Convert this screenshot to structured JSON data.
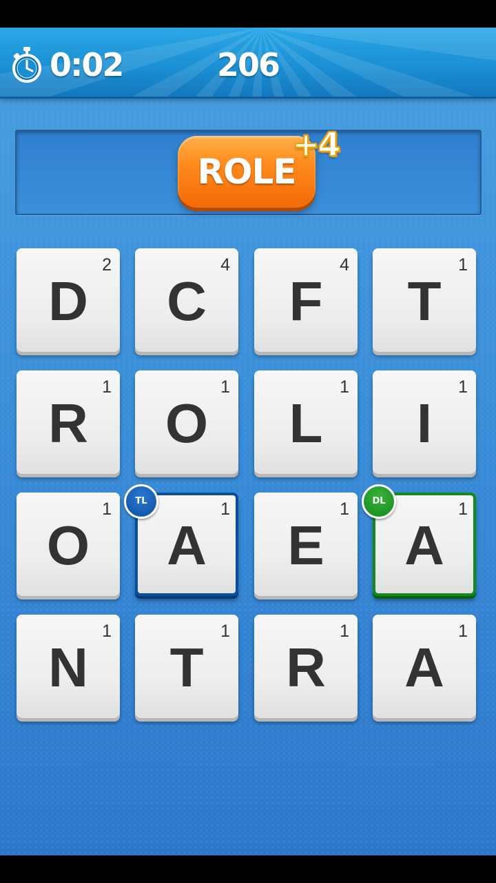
{
  "header": {
    "timer": "0:02",
    "score": "206",
    "timer_icon": "stopwatch-icon"
  },
  "word": {
    "current": "ROLE",
    "bonus": "+4"
  },
  "board": {
    "tiles": [
      {
        "letter": "D",
        "points": "2",
        "multiplier": ""
      },
      {
        "letter": "C",
        "points": "4",
        "multiplier": ""
      },
      {
        "letter": "F",
        "points": "4",
        "multiplier": ""
      },
      {
        "letter": "T",
        "points": "1",
        "multiplier": ""
      },
      {
        "letter": "R",
        "points": "1",
        "multiplier": ""
      },
      {
        "letter": "O",
        "points": "1",
        "multiplier": ""
      },
      {
        "letter": "L",
        "points": "1",
        "multiplier": ""
      },
      {
        "letter": "I",
        "points": "1",
        "multiplier": ""
      },
      {
        "letter": "O",
        "points": "1",
        "multiplier": ""
      },
      {
        "letter": "A",
        "points": "1",
        "multiplier": "TL"
      },
      {
        "letter": "E",
        "points": "1",
        "multiplier": ""
      },
      {
        "letter": "A",
        "points": "1",
        "multiplier": "DL"
      },
      {
        "letter": "N",
        "points": "1",
        "multiplier": ""
      },
      {
        "letter": "T",
        "points": "1",
        "multiplier": ""
      },
      {
        "letter": "R",
        "points": "1",
        "multiplier": ""
      },
      {
        "letter": "A",
        "points": "1",
        "multiplier": ""
      }
    ]
  },
  "colors": {
    "background_blue": "#3a8dd8",
    "word_pill_orange": "#ff8a1c",
    "triple_letter_blue": "#0b4f9a",
    "double_letter_green": "#148a1a"
  }
}
